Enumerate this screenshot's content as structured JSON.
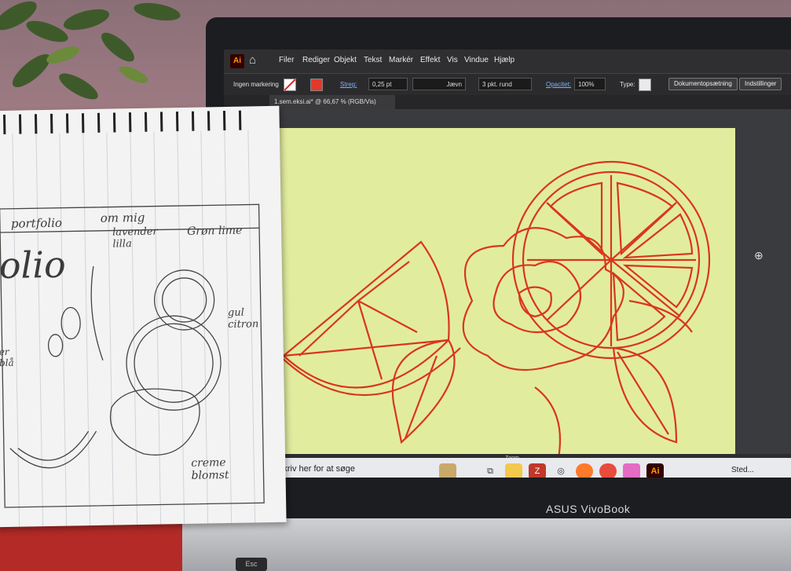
{
  "app": {
    "logo_label": "Ai",
    "menu": [
      "Filer",
      "Rediger",
      "Objekt",
      "Tekst",
      "Markér",
      "Effekt",
      "Vis",
      "Vindue",
      "Hjælp"
    ]
  },
  "control_bar": {
    "selection_label": "Ingen markering",
    "stroke_label": "Streg:",
    "stroke_value": "0,25 pt",
    "line_style": "Jævn",
    "brush_label": "3 pkt. rund",
    "opacity_label": "Opacitet:",
    "opacity_value": "100%",
    "type_label": "Type:",
    "document_setup_button": "Dokumentopsætning",
    "preferences_button": "Indstillinger"
  },
  "document": {
    "tab_label": "1.sem.eksi.ai* @ 66,67 % (RGB/Vis)",
    "artboard_color": "#e2ec9f",
    "art_color": "#d9361c"
  },
  "status": {
    "zoom_label": "Zoom"
  },
  "taskbar": {
    "search_placeholder": "Skriv her for at søge",
    "weather_label": "Sted..."
  },
  "laptop": {
    "brand": "ASUS VivoBook",
    "esc_key": "Esc"
  },
  "notebook": {
    "portfolio": "portfolio",
    "om_mig": "om mig",
    "lavender": "lavender\nlilla",
    "lime": "Grøn lime",
    "lemon": "gul\ncitron",
    "flower": "creme\nblomst",
    "big_portfolio": "olio",
    "blue_label": "er\nblå"
  }
}
